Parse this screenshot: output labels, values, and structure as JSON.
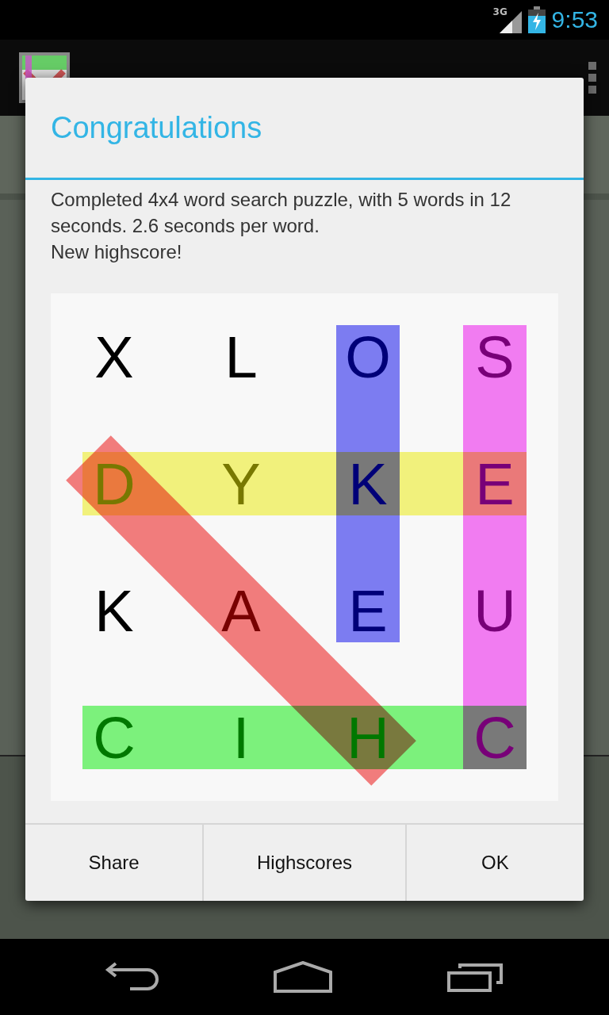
{
  "status_bar": {
    "network": "3G",
    "time": "9:53"
  },
  "dialog": {
    "title": "Congratulations",
    "message": "Completed 4x4 word search puzzle, with 5 words in 12 seconds. 2.6 seconds per word.",
    "note": "New highscore!",
    "grid": {
      "rows": [
        [
          "X",
          "L",
          "O",
          "S"
        ],
        [
          "D",
          "Y",
          "K",
          "E"
        ],
        [
          "K",
          "A",
          "E",
          "U"
        ],
        [
          "C",
          "I",
          "H",
          "C"
        ]
      ],
      "highlights": [
        {
          "color": "#8080f8"
        },
        {
          "color": "#f880f8"
        },
        {
          "color": "#f8f880"
        },
        {
          "color": "#80f880"
        },
        {
          "color": "#f88080"
        }
      ]
    },
    "buttons": [
      "Share",
      "Highscores",
      "OK"
    ]
  }
}
